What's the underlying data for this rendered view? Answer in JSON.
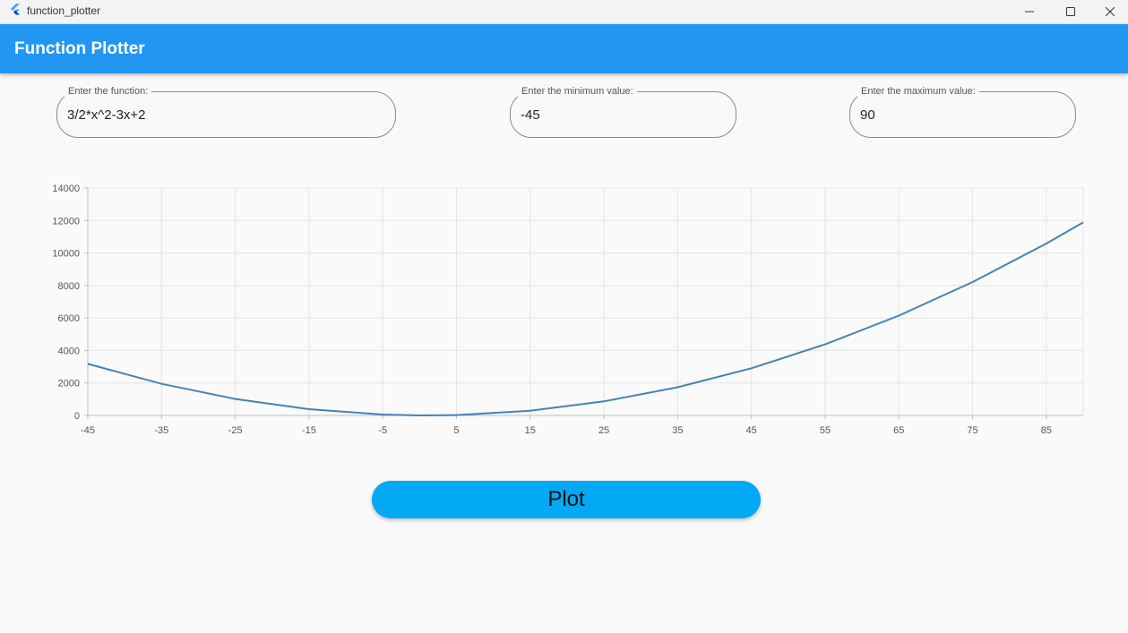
{
  "window": {
    "title": "function_plotter"
  },
  "appbar": {
    "title": "Function Plotter"
  },
  "inputs": {
    "function": {
      "label": "Enter the function:",
      "value": "3/2*x^2-3x+2"
    },
    "min": {
      "label": "Enter the minimum value:",
      "value": "-45"
    },
    "max": {
      "label": "Enter the maximum value:",
      "value": "90"
    }
  },
  "chart_data": {
    "type": "line",
    "title": "",
    "xlabel": "",
    "ylabel": "",
    "xlim": [
      -45,
      90
    ],
    "ylim": [
      0,
      14000
    ],
    "x_ticks": [
      -45,
      -35,
      -25,
      -15,
      -5,
      5,
      15,
      25,
      35,
      45,
      55,
      65,
      75,
      85
    ],
    "y_ticks": [
      0,
      2000,
      4000,
      6000,
      8000,
      10000,
      12000,
      14000
    ],
    "grid": true,
    "legend": "none",
    "line_color": "#4682b4",
    "series": [
      {
        "x": [
          -45,
          -35,
          -25,
          -15,
          -5,
          0,
          5,
          15,
          25,
          35,
          45,
          55,
          65,
          75,
          85,
          90
        ],
        "y": [
          3174.5,
          1944.5,
          1014.5,
          384.5,
          54.5,
          2,
          24.5,
          294.5,
          864.5,
          1734.5,
          2904.5,
          4374.5,
          6144.5,
          8214.5,
          10584.5,
          11882
        ]
      }
    ]
  },
  "plot_button": {
    "label": "Plot",
    "color": "#03a9f4"
  },
  "colors": {
    "appbar": "#2196f3",
    "background": "#f9f9f9"
  }
}
